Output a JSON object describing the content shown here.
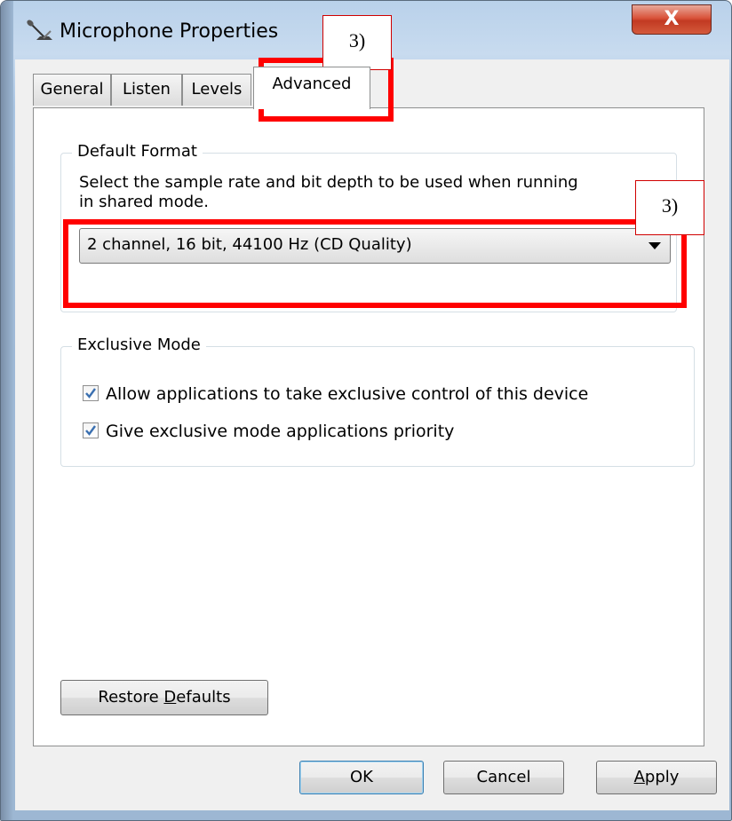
{
  "window": {
    "title": "Microphone Properties",
    "close_glyph": "X"
  },
  "tabs": [
    {
      "label": "General"
    },
    {
      "label": "Listen"
    },
    {
      "label": "Levels"
    },
    {
      "label": "Advanced",
      "active": true
    }
  ],
  "default_format": {
    "group_label": "Default Format",
    "description_line1": "Select the sample rate and bit depth to be used when running",
    "description_line2": "in shared mode.",
    "selected_format": "2 channel, 16 bit, 44100 Hz (CD Quality)"
  },
  "exclusive_mode": {
    "group_label": "Exclusive Mode",
    "options": [
      {
        "label": "Allow applications to take exclusive control of this device",
        "checked": true
      },
      {
        "label": "Give exclusive mode applications priority",
        "checked": true
      }
    ]
  },
  "buttons": {
    "restore_defaults_pre": "Restore ",
    "restore_defaults_mnemonic": "D",
    "restore_defaults_post": "efaults",
    "ok": "OK",
    "cancel": "Cancel",
    "apply_mnemonic": "A",
    "apply_post": "pply"
  },
  "annotations": {
    "tab_callout": "3)",
    "format_callout": "3)"
  },
  "colors": {
    "annotation_red": "#ff0000",
    "check_blue": "#3a6fb0"
  }
}
